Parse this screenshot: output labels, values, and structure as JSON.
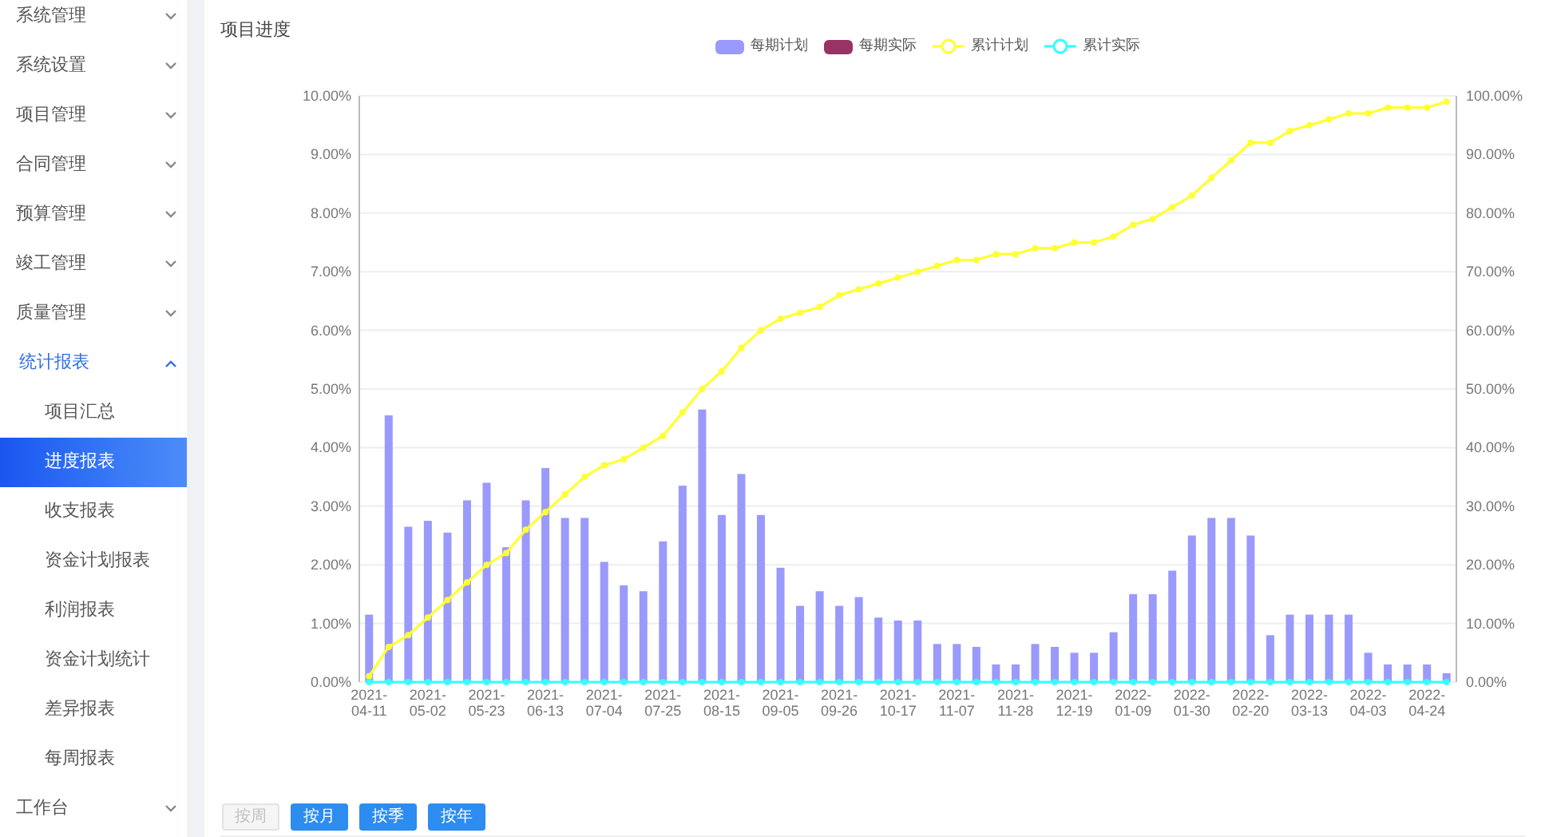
{
  "sidebar": {
    "items": [
      {
        "label": "系统管理",
        "expanded": false
      },
      {
        "label": "系统设置",
        "expanded": false
      },
      {
        "label": "项目管理",
        "expanded": false
      },
      {
        "label": "合同管理",
        "expanded": false
      },
      {
        "label": "预算管理",
        "expanded": false
      },
      {
        "label": "竣工管理",
        "expanded": false
      },
      {
        "label": "质量管理",
        "expanded": false
      },
      {
        "label": "统计报表",
        "expanded": true,
        "children": [
          {
            "label": "项目汇总",
            "selected": false
          },
          {
            "label": "进度报表",
            "selected": true
          },
          {
            "label": "收支报表",
            "selected": false
          },
          {
            "label": "资金计划报表",
            "selected": false
          },
          {
            "label": "利润报表",
            "selected": false
          },
          {
            "label": "资金计划统计",
            "selected": false
          },
          {
            "label": "差异报表",
            "selected": false
          },
          {
            "label": "每周报表",
            "selected": false
          }
        ]
      },
      {
        "label": "工作台",
        "expanded": false
      }
    ]
  },
  "panel": {
    "title": "项目进度",
    "charts": [
      {
        "chart_data": {
          "type": "bar",
          "grid": true,
          "categories": [
            "2021-04-11",
            null,
            null,
            "2021-05-02",
            null,
            null,
            "2021-05-23",
            null,
            null,
            "2021-06-13",
            null,
            null,
            "2021-07-04",
            null,
            null,
            "2021-07-25",
            null,
            null,
            "2021-08-15",
            null,
            null,
            "2021-09-05",
            null,
            null,
            "2021-09-26",
            null,
            null,
            "2021-10-17",
            null,
            null,
            "2021-11-07",
            null,
            null,
            "2021-11-28",
            null,
            null,
            "2021-12-19",
            null,
            null,
            "2022-01-09",
            null,
            null,
            "2022-01-30",
            null,
            null,
            "2022-02-20",
            null,
            null,
            "2022-03-13",
            null,
            null,
            "2022-04-03",
            null,
            null,
            "2022-04-24",
            null
          ],
          "series": [
            {
              "name": "每期计划",
              "color": "#9a9afc",
              "values": [
                1.15,
                4.55,
                2.65,
                2.75,
                2.55,
                3.1,
                3.4,
                2.3,
                3.1,
                3.65,
                2.8,
                2.8,
                2.05,
                1.65,
                1.55,
                2.4,
                3.35,
                4.65,
                2.85,
                3.55,
                2.85,
                1.95,
                1.3,
                1.55,
                1.3,
                1.45,
                1.1,
                1.05,
                1.05,
                0.65,
                0.65,
                0.6,
                0.3,
                0.3,
                0.65,
                0.6,
                0.5,
                0.5,
                0.85,
                1.5,
                1.5,
                1.9,
                2.5,
                2.8,
                2.8,
                2.5,
                0.8,
                1.15,
                1.15,
                1.15,
                1.15,
                0.5,
                0.3,
                0.3,
                0.3,
                0.15
              ]
            },
            {
              "name": "每期实际",
              "color": "#993366",
              "values": [
                0,
                0,
                0,
                0,
                0,
                0,
                0,
                0,
                0,
                0,
                0,
                0,
                0,
                0,
                0,
                0,
                0,
                0,
                0,
                0,
                0,
                0,
                0,
                0,
                0,
                0,
                0,
                0,
                0,
                0,
                0,
                0,
                0,
                0,
                0,
                0,
                0,
                0,
                0,
                0,
                0,
                0,
                0,
                0,
                0,
                0,
                0,
                0,
                0,
                0,
                0,
                0,
                0,
                0,
                0,
                0
              ]
            }
          ],
          "ylim": [
            0,
            10
          ],
          "yticks": [
            {
              "value": 0,
              "label": "0.00%"
            },
            {
              "value": 1,
              "label": "1.00%"
            },
            {
              "value": 2,
              "label": "2.00%"
            },
            {
              "value": 3,
              "label": "3.00%"
            },
            {
              "value": 4,
              "label": "4.00%"
            },
            {
              "value": 5,
              "label": "5.00%"
            },
            {
              "value": 6,
              "label": "6.00%"
            },
            {
              "value": 7,
              "label": "7.00%"
            },
            {
              "value": 8,
              "label": "8.00%"
            },
            {
              "value": 9,
              "label": "9.00%"
            },
            {
              "value": 10,
              "label": "10.00%"
            }
          ]
        }
      },
      {
        "chart_data": {
          "type": "line",
          "series": [
            {
              "name": "累计计划",
              "color": "#ffff33",
              "marker": true,
              "values": [
                1,
                6,
                8,
                11,
                14,
                17,
                20,
                22,
                26,
                29,
                32,
                35,
                37,
                38,
                40,
                42,
                46,
                50,
                53,
                57,
                60,
                62,
                63,
                64,
                66,
                67,
                68,
                69,
                70,
                71,
                72,
                72,
                73,
                73,
                74,
                74,
                75,
                75,
                76,
                78,
                79,
                81,
                83,
                86,
                89,
                92,
                92,
                94,
                95,
                96,
                97,
                97,
                98,
                98,
                98,
                99
              ]
            },
            {
              "name": "累计实际",
              "color": "#33ffff",
              "marker": true,
              "values": [
                0,
                0,
                0,
                0,
                0,
                0,
                0,
                0,
                0,
                0,
                0,
                0,
                0,
                0,
                0,
                0,
                0,
                0,
                0,
                0,
                0,
                0,
                0,
                0,
                0,
                0,
                0,
                0,
                0,
                0,
                0,
                0,
                0,
                0,
                0,
                0,
                0,
                0,
                0,
                0,
                0,
                0,
                0,
                0,
                0,
                0,
                0,
                0,
                0,
                0,
                0,
                0,
                0,
                0,
                0,
                0
              ]
            }
          ],
          "ylim": [
            0,
            100
          ],
          "yticks": [
            {
              "value": 0,
              "label": "0.00%"
            },
            {
              "value": 10,
              "label": "10.00%"
            },
            {
              "value": 20,
              "label": "20.00%"
            },
            {
              "value": 30,
              "label": "30.00%"
            },
            {
              "value": 40,
              "label": "40.00%"
            },
            {
              "value": 50,
              "label": "50.00%"
            },
            {
              "value": 60,
              "label": "60.00%"
            },
            {
              "value": 70,
              "label": "70.00%"
            },
            {
              "value": 80,
              "label": "80.00%"
            },
            {
              "value": 90,
              "label": "90.00%"
            },
            {
              "value": 100,
              "label": "100.00%"
            }
          ]
        }
      }
    ],
    "buttons": [
      {
        "label": "按周",
        "disabled": true
      },
      {
        "label": "按月",
        "disabled": false
      },
      {
        "label": "按季",
        "disabled": false
      },
      {
        "label": "按年",
        "disabled": false
      }
    ]
  }
}
